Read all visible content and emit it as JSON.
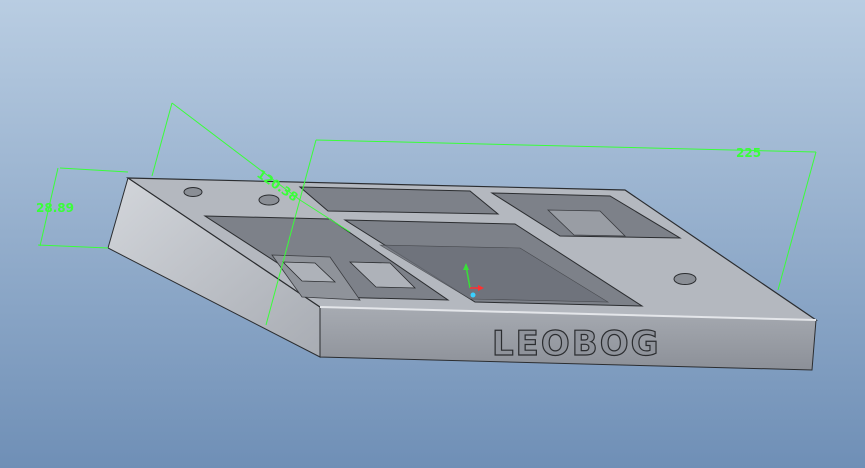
{
  "dimensions": {
    "height": "28.89",
    "depth": "120.38",
    "width": "225"
  },
  "model": {
    "emboss_text": "LEOBOG"
  },
  "colors": {
    "bg_top": "#b9cde2",
    "bg_bottom": "#6f8fb6",
    "dimension_line": "#39ff39",
    "part_top": "#b4b8bf",
    "part_front": "#9a9ea6",
    "part_side": "#c7cad0",
    "part_edge": "#2b2d30",
    "cutout_floor": "#7d8189"
  },
  "icons": {
    "axis_triad": "coordinate-triad-icon"
  }
}
